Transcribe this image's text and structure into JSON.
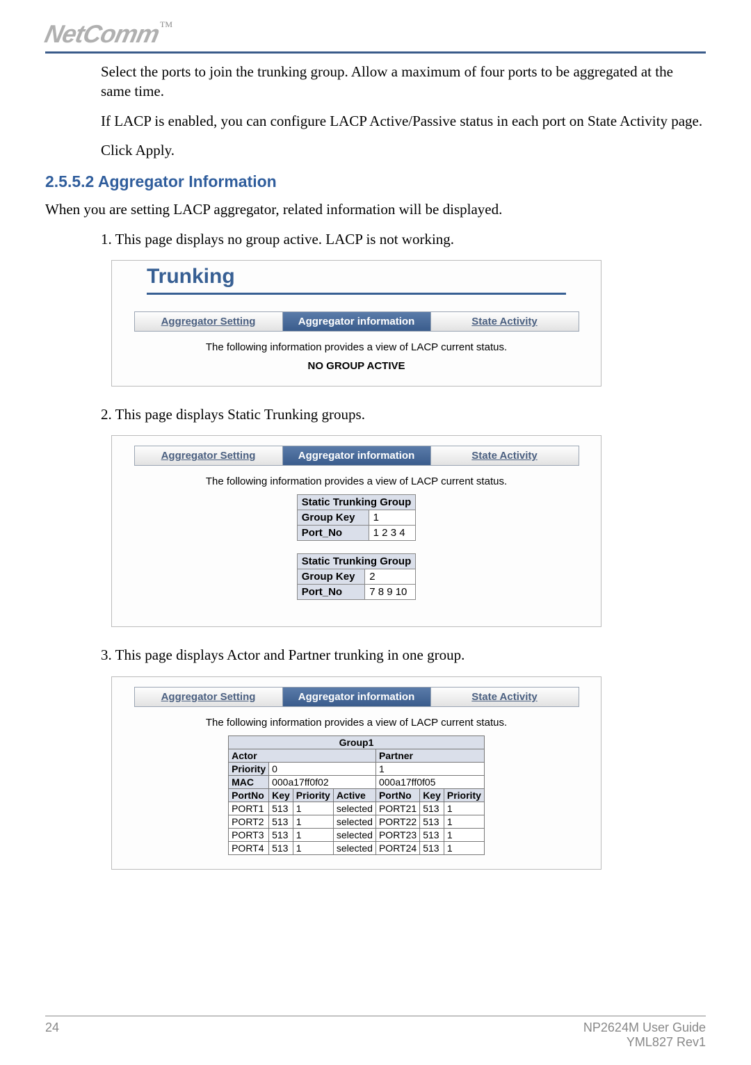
{
  "logo": {
    "brand": "NetComm",
    "tm": "TM"
  },
  "intro": {
    "p1": "Select the ports to join the trunking group.  Allow a maximum of four ports to be aggregated at the same time.",
    "p2": "If LACP is enabled, you can configure LACP Active/Passive status in each port on State Activity page.",
    "p3": "Click Apply."
  },
  "section": {
    "number_title": "2.5.5.2 Aggregator Information",
    "lead": "When you are setting LACP aggregator, related information will be displayed.",
    "item1": "1. This page displays no group active.  LACP is not working.",
    "item2": "2. This page displays Static Trunking groups.",
    "item3": "3. This page displays Actor and Partner trunking in one group."
  },
  "tabs": {
    "setting": "Aggregator Setting",
    "info": "Aggregator information",
    "state": "State Activity"
  },
  "shot_common": {
    "caption": "The following information provides a view of LACP current status."
  },
  "shot1": {
    "title": "Trunking",
    "no_group": "NO GROUP ACTIVE"
  },
  "shot2": {
    "group_hdr": "Static Trunking Group",
    "row_key": "Group Key",
    "row_port": "Port_No",
    "g1_key": "1",
    "g1_ports": "1 2 3 4",
    "g2_key": "2",
    "g2_ports": "7 8 9 10"
  },
  "shot3": {
    "group_title": "Group1",
    "actor": "Actor",
    "partner": "Partner",
    "priority_label": "Priority",
    "mac_label": "MAC",
    "actor_priority": "0",
    "partner_priority": "1",
    "actor_mac": "000a17ff0f02",
    "partner_mac": "000a17ff0f05",
    "h_portno": "PortNo",
    "h_key": "Key",
    "h_priority": "Priority",
    "h_active": "Active",
    "rows": [
      {
        "ap": "PORT1",
        "ak": "513",
        "apr": "1",
        "aact": "selected",
        "pp": "PORT21",
        "pk": "513",
        "ppr": "1"
      },
      {
        "ap": "PORT2",
        "ak": "513",
        "apr": "1",
        "aact": "selected",
        "pp": "PORT22",
        "pk": "513",
        "ppr": "1"
      },
      {
        "ap": "PORT3",
        "ak": "513",
        "apr": "1",
        "aact": "selected",
        "pp": "PORT23",
        "pk": "513",
        "ppr": "1"
      },
      {
        "ap": "PORT4",
        "ak": "513",
        "apr": "1",
        "aact": "selected",
        "pp": "PORT24",
        "pk": "513",
        "ppr": "1"
      }
    ]
  },
  "footer": {
    "page": "24",
    "guide": "NP2624M User Guide",
    "rev": "YML827 Rev1"
  }
}
